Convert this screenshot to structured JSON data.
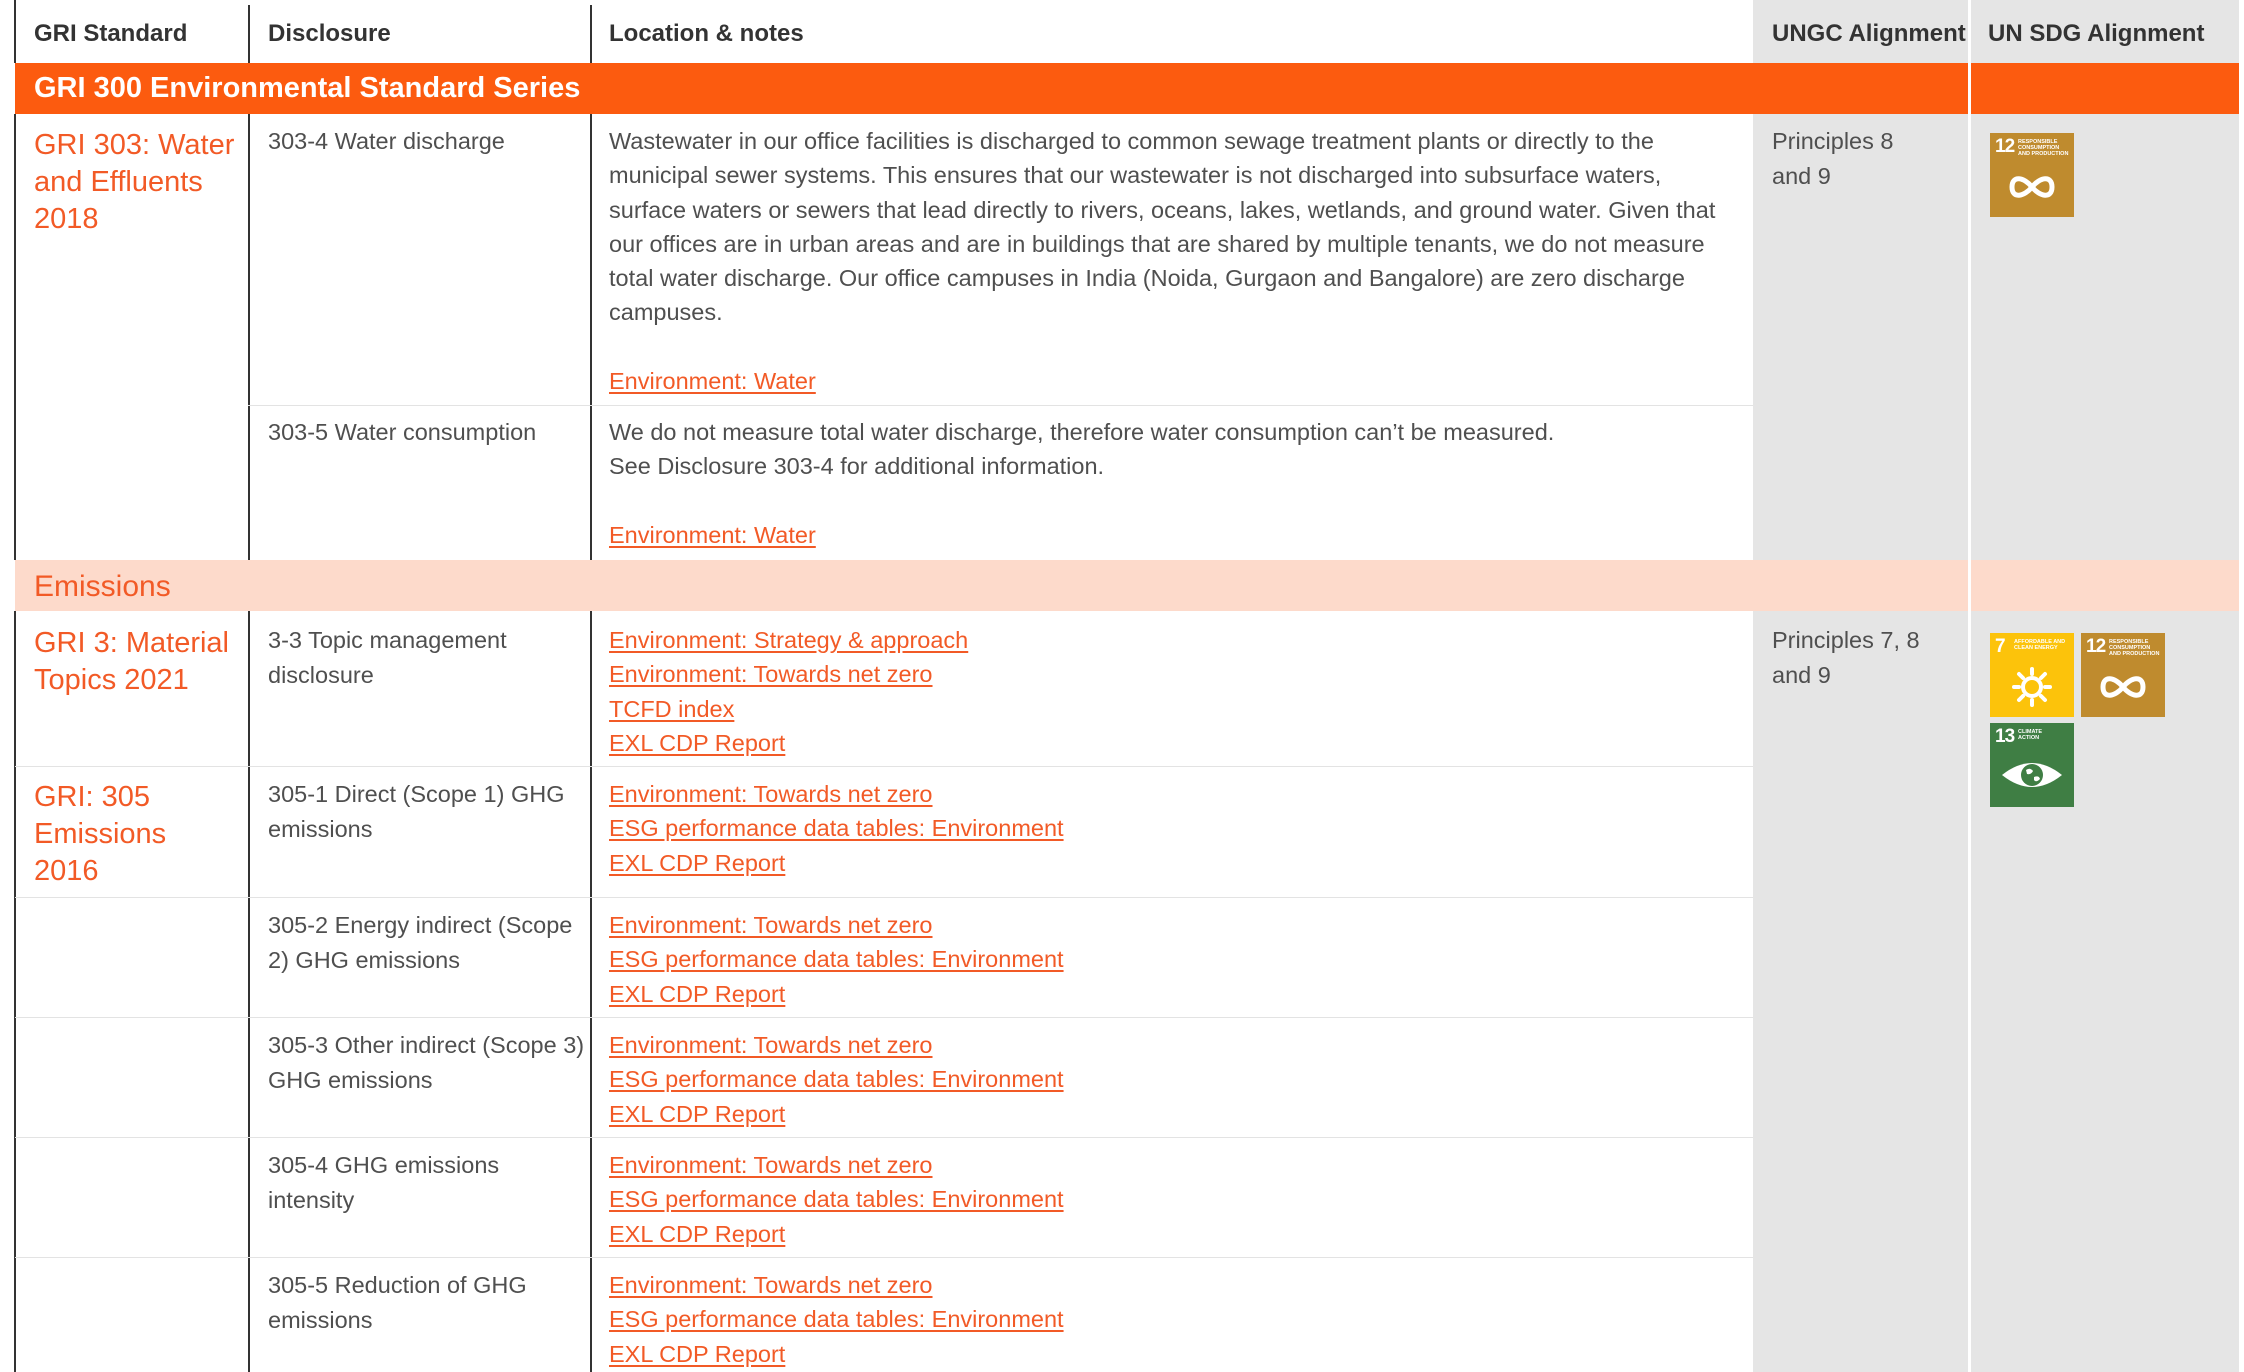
{
  "header": {
    "col_standard": "GRI Standard",
    "col_disclosure": "Disclosure",
    "col_notes": "Location & notes",
    "col_ungc": "UNGC Alignment",
    "col_sdg": "UN SDG Alignment"
  },
  "series_band": {
    "title": "GRI 300 Environmental Standard Series"
  },
  "water": {
    "standard": "GRI 303: Water and Effluents 2018",
    "rows": [
      {
        "disclosure": "303-4 Water discharge",
        "note": "Wastewater in our office facilities is discharged to common sewage treatment plants or directly to the municipal sewer systems. This ensures that our wastewater is not discharged into subsurface waters, surface waters or sewers that lead directly to rivers, oceans, lakes, wetlands, and ground water. Given that our offices are in urban areas and are in buildings that are shared by multiple tenants, we do not measure total water discharge. Our office campuses in India (Noida, Gurgaon and Bangalore) are zero discharge campuses.",
        "link": "Environment: Water"
      },
      {
        "disclosure": "303-5 Water consumption",
        "note_line1": "We do not measure total water discharge, therefore water consumption can’t be measured.",
        "note_line2": "See Disclosure 303-4 for additional information.",
        "link": "Environment: Water"
      }
    ],
    "ungc": "Principles 8 and 9",
    "sdgs": [
      {
        "number": "12",
        "caption": "RESPONSIBLE CONSUMPTION AND PRODUCTION",
        "color": "#bf8b2e",
        "icon": "infinity-icon"
      }
    ]
  },
  "emissions_band": {
    "title": "Emissions"
  },
  "emissions": {
    "standard_1": "GRI 3: Material Topics 2021",
    "standard_2": "GRI: 305 Emissions 2016",
    "rows": [
      {
        "disclosure": "3-3 Topic management disclosure",
        "links": [
          "Environment: Strategy & approach",
          "Environment: Towards net zero ",
          "TCFD index",
          "EXL CDP Report"
        ]
      },
      {
        "disclosure": "305-1 Direct (Scope 1) GHG emissions",
        "links": [
          "Environment: Towards net zero ",
          "ESG performance data tables: Environment",
          "EXL CDP Report"
        ]
      },
      {
        "disclosure": "305-2 Energy indirect (Scope 2) GHG emissions",
        "links": [
          "Environment: Towards net zero ",
          "ESG performance data tables: Environment",
          "EXL CDP Report"
        ]
      },
      {
        "disclosure": "305-3 Other indirect (Scope 3) GHG emissions",
        "links": [
          "Environment: Towards net zero ",
          "ESG performance data tables: Environment",
          "EXL CDP Report"
        ]
      },
      {
        "disclosure": "305-4 GHG emissions intensity",
        "links": [
          "Environment: Towards net zero ",
          "ESG performance data tables: Environment",
          "EXL CDP Report"
        ]
      },
      {
        "disclosure": "305-5 Reduction of GHG emissions",
        "links": [
          "Environment: Towards net zero ",
          "ESG performance data tables: Environment",
          "EXL CDP Report"
        ]
      }
    ],
    "ungc": "Principles 7, 8 and 9",
    "sdgs": [
      {
        "number": "7",
        "caption": "AFFORDABLE AND CLEAN ENERGY",
        "color": "#fcc30b",
        "icon": "sun-icon"
      },
      {
        "number": "12",
        "caption": "RESPONSIBLE CONSUMPTION AND PRODUCTION",
        "color": "#bf8b2e",
        "icon": "infinity-icon"
      },
      {
        "number": "13",
        "caption": "CLIMATE ACTION",
        "color": "#3f7e44",
        "icon": "eye-globe-icon"
      }
    ]
  },
  "colors": {
    "accent_orange": "#fc5b0f",
    "link_orange": "#f25a26",
    "peach_band": "#fddacb",
    "alignment_column_bg": "#e5e5e5"
  }
}
